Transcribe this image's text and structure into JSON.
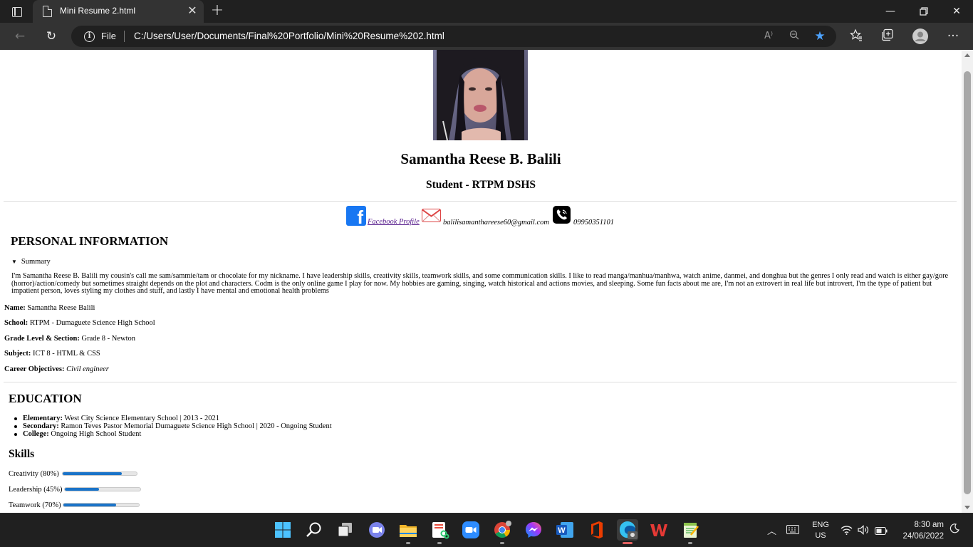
{
  "browser": {
    "tab_title": "Mini Resume 2.html",
    "address_scheme_label": "File",
    "address_url": "C:/Users/User/Documents/Final%20Portfolio/Mini%20Resume%202.html"
  },
  "profile": {
    "name": "Samantha Reese B. Balili",
    "role": "Student - RTPM DSHS",
    "facebook_label": "Facebook Profile",
    "email": "balilisamanthareese60@gmail.com",
    "phone": "09950351101"
  },
  "personal": {
    "heading": "PERSONAL INFORMATION",
    "summary_label": "Summary",
    "summary_text": "I'm Samantha Reese B. Balili my cousin's call me sam/sammie/tam or chocolate for my nickname. I have leadership skills, creativity skills, teamwork skills, and some communication skills. I like to read manga/manhua/manhwa, watch anime, danmei, and donghua but the genres I only read and watch is either gay/gore (horror)/action/comedy but sometimes straight depends on the plot and characters. Codm is the only online game I play for now. My hobbies are gaming, singing, watch historical and actions movies, and sleeping. Some fun facts about me are, I'm not an extrovert in real life but introvert, I'm the type of patient but impatient person, loves styling my clothes and stuff, and lastly I have mental and emotional health problems",
    "fields": [
      {
        "label": "Name:",
        "value": "Samantha Reese Balili"
      },
      {
        "label": "School:",
        "value": "RTPM - Dumaguete Science High School"
      },
      {
        "label": "Grade Level & Section:",
        "value": "Grade 8 - Newton"
      },
      {
        "label": "Subject:",
        "value": "ICT 8 - HTML & CSS"
      },
      {
        "label": "Career Objectives:",
        "value": "Civil engineer"
      }
    ]
  },
  "education": {
    "heading": "EDUCATION",
    "items": [
      {
        "label": "Elementary:",
        "value": "West City Science Elementary School | 2013 - 2021"
      },
      {
        "label": "Secondary:",
        "value": "Ramon Teves Pastor Memorial Dumaguete Science High School | 2020 - Ongoing Student"
      },
      {
        "label": "College:",
        "value": "Ongoing High School Student"
      }
    ]
  },
  "skills": {
    "heading": "Skills",
    "items": [
      {
        "label": "Creativity (80%)",
        "level": 0.8
      },
      {
        "label": "Leadership (45%)",
        "level": 0.45
      },
      {
        "label": "Teamwork (70%)",
        "level": 0.7
      }
    ]
  },
  "system": {
    "lang_1": "ENG",
    "lang_2": "US",
    "time": "8:30 am",
    "date": "24/06/2022"
  },
  "colors": {
    "accent": "#1a73c8",
    "favorite_star": "#4da3ff",
    "facebook": "#1877f2"
  }
}
